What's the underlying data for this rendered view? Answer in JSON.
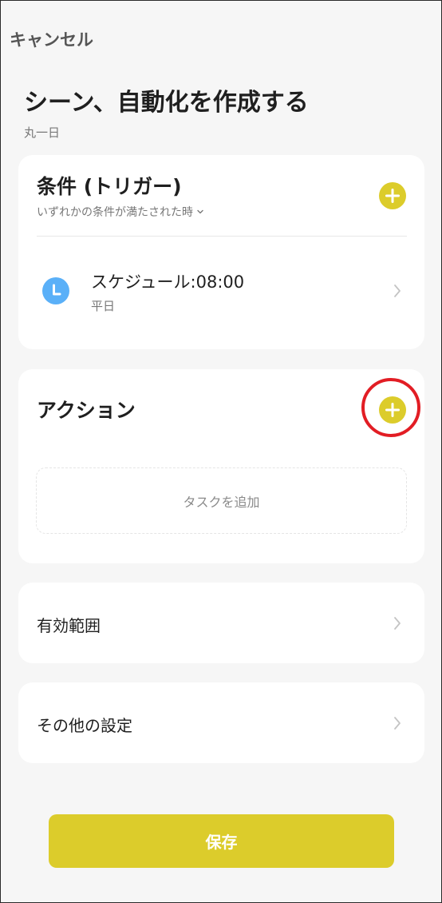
{
  "header": {
    "cancel_label": "キャンセル"
  },
  "page": {
    "title": "シーン、自動化を作成する",
    "subtitle": "丸一日"
  },
  "trigger_card": {
    "title": "条件 (トリガー)",
    "mode_label": "いずれかの条件が満たされた時",
    "items": [
      {
        "icon": "clock-icon",
        "title": "スケジュール:08:00",
        "subtitle": "平日"
      }
    ]
  },
  "action_card": {
    "title": "アクション",
    "add_task_label": "タスクを追加"
  },
  "scope_row": {
    "label": "有効範囲"
  },
  "other_row": {
    "label": "その他の設定"
  },
  "footer": {
    "save_label": "保存"
  },
  "colors": {
    "accent": "#dccc2b",
    "clock": "#5ab0f8",
    "highlight": "#e21d24",
    "background": "#f6f6f6"
  }
}
